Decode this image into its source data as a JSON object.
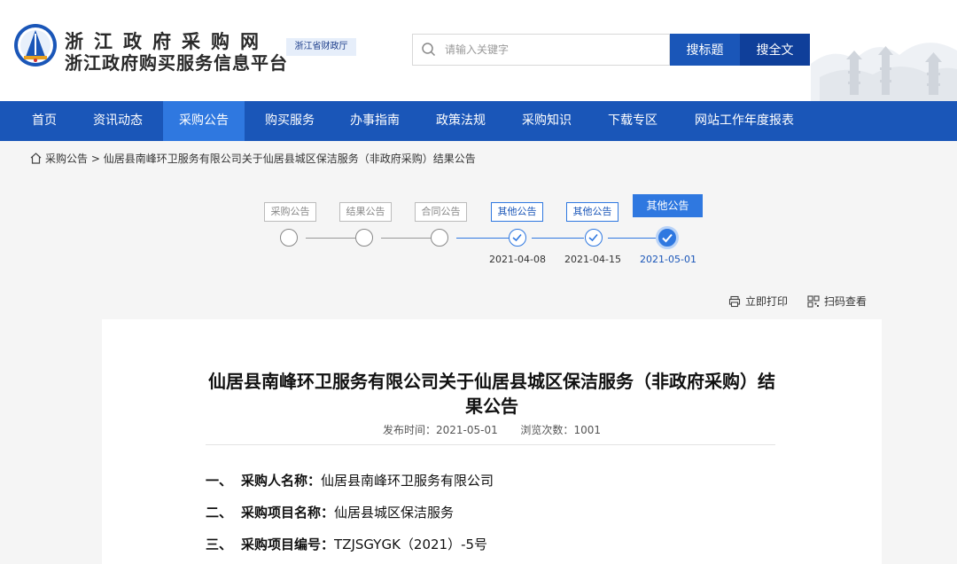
{
  "header": {
    "title_line1": "浙江政府采购网",
    "title_line2": "浙江政府购买服务信息平台",
    "dept_badge": "浙江省财政厅",
    "search_placeholder": "请输入关键字",
    "btn_search_title": "搜标题",
    "btn_search_full": "搜全文"
  },
  "nav": {
    "items": [
      {
        "label": "首页"
      },
      {
        "label": "资讯动态"
      },
      {
        "label": "采购公告",
        "active": true
      },
      {
        "label": "购买服务"
      },
      {
        "label": "办事指南"
      },
      {
        "label": "政策法规"
      },
      {
        "label": "采购知识"
      },
      {
        "label": "下载专区"
      },
      {
        "label": "网站工作年度报表"
      }
    ]
  },
  "breadcrumb": {
    "root": "采购公告",
    "sep": " > ",
    "current": "仙居县南峰环卫服务有限公司关于仙居县城区保洁服务（非政府采购）结果公告"
  },
  "timeline": {
    "steps": [
      {
        "label": "采购公告",
        "status": "pending",
        "date": ""
      },
      {
        "label": "结果公告",
        "status": "pending",
        "date": ""
      },
      {
        "label": "合同公告",
        "status": "pending",
        "date": ""
      },
      {
        "label": "其他公告",
        "status": "done",
        "date": "2021-04-08"
      },
      {
        "label": "其他公告",
        "status": "done",
        "date": "2021-04-15"
      },
      {
        "label": "其他公告",
        "status": "current",
        "date": "2021-05-01"
      }
    ]
  },
  "tools": {
    "print": "立即打印",
    "qrcode": "扫码查看"
  },
  "article": {
    "title": "仙居县南峰环卫服务有限公司关于仙居县城区保洁服务（非政府采购）结果公告",
    "publish_label": "发布时间：",
    "publish_date": "2021-05-01",
    "views_label": "浏览次数：",
    "views": "1001",
    "items": [
      {
        "num": "一、",
        "key": "采购人名称：",
        "value": "仙居县南峰环卫服务有限公司"
      },
      {
        "num": "二、",
        "key": "采购项目名称：",
        "value": "仙居县城区保洁服务"
      },
      {
        "num": "三、",
        "key": "采购项目编号：",
        "value": "TZJSGYGK（2021）-5号"
      }
    ]
  },
  "colors": {
    "nav_bg": "#1a56b8",
    "nav_active": "#2f78e0",
    "accent": "#1a56b8"
  }
}
